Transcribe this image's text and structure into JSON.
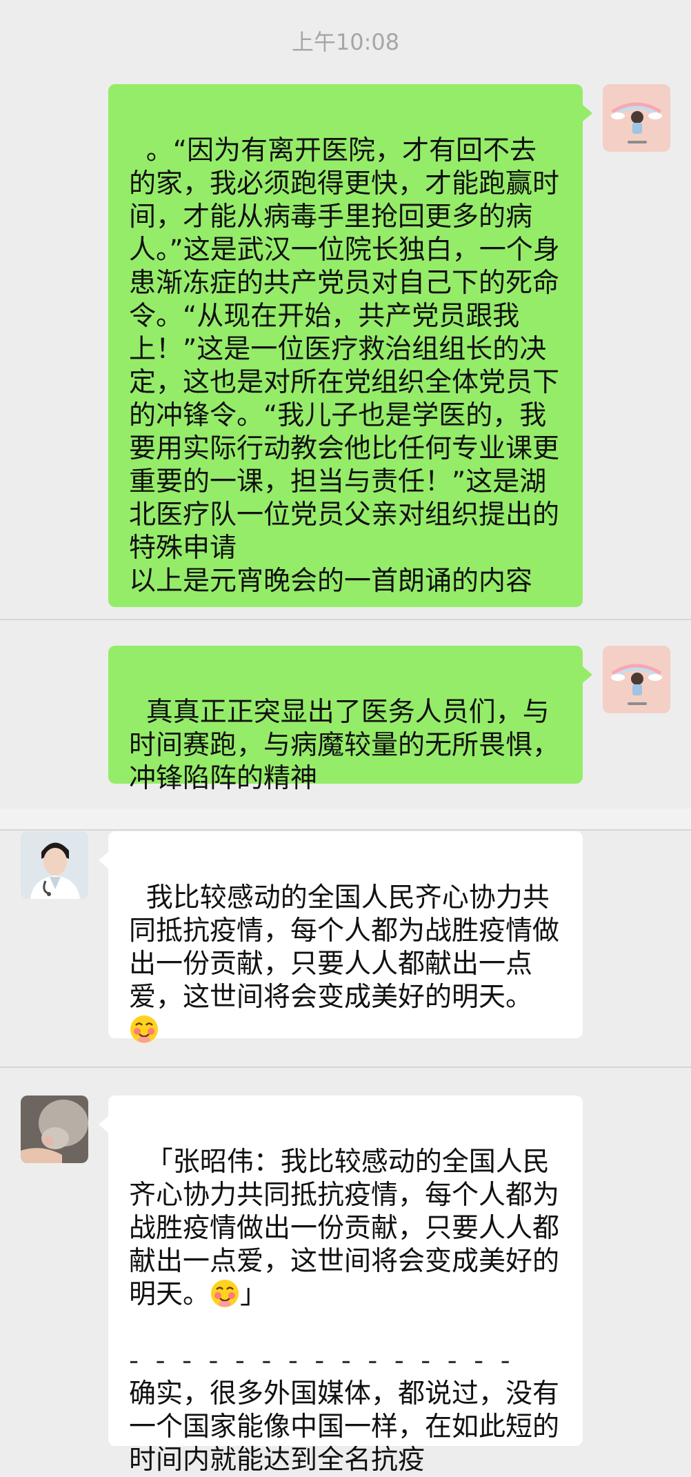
{
  "chat": {
    "timestamp": "上午10:08",
    "messages": [
      {
        "direction": "sent",
        "avatar": "pink-cartoon-girl-avatar",
        "text": "。“因为有离开医院，才有回不去的家，我必须跑得更快，才能跑赢时间，才能从病毒手里抢回更多的病人。”这是武汉一位院长独白，一个身患渐冻症的共产党员对自己下的死命令。“从现在开始，共产党员跟我上！”这是一位医疗救治组组长的决定，这也是对所在党组织全体党员下的冲锋令。“我儿子也是学医的，我要用实际行动教会他比任何专业课更重要的一课，担当与责任！”这是湖北医疗队一位党员父亲对组织提出的特殊申请\n以上是元宵晚会的一首朗诵的内容"
      },
      {
        "direction": "sent",
        "avatar": "pink-cartoon-girl-avatar",
        "text": "真真正正突显出了医务人员们，与时间赛跑，与病魔较量的无所畏惧，冲锋陷阵的精神"
      },
      {
        "direction": "received",
        "avatar": "doctor-avatar",
        "text": "我比较感动的全国人民齐心协力共同抵抗疫情，每个人都为战胜疫情做出一份贡献，只要人人都献出一点爱，这世间将会变成美好的明天。",
        "emoji": "blush-emoji"
      },
      {
        "direction": "received",
        "avatar": "cat-paw-avatar",
        "quote_text": "「张昭伟：我比较感动的全国人民齐心协力共同抵抗疫情，每个人都为战胜疫情做出一份贡献，只要人人都献出一点爱，这世间将会变成美好的明天。",
        "quote_end": "」",
        "emoji": "blush-emoji",
        "separator": "- - - - - - - - - - - - - - -",
        "text": "确实，很多外国媒体，都说过，没有一个国家能像中国一样，在如此短的时间内就能达到全名抗疫"
      }
    ]
  },
  "colors": {
    "background": "#ededed",
    "sent_bubble": "#95ec69",
    "received_bubble": "#ffffff",
    "timestamp": "#a6a6a6"
  }
}
